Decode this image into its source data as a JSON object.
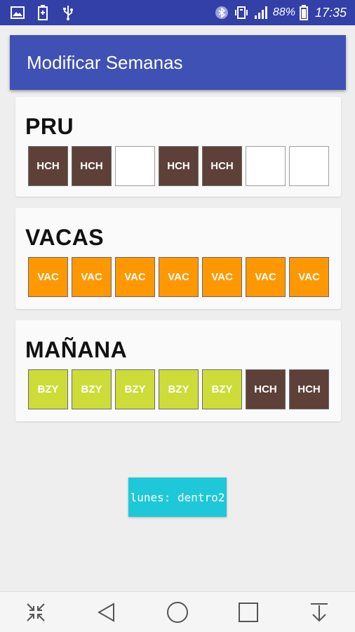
{
  "status_bar": {
    "battery": "88%",
    "time": "17:35",
    "icons": [
      "image-icon",
      "battery-saver-icon",
      "usb-icon",
      "bluetooth-icon",
      "vibrate-icon",
      "signal-icon",
      "battery-icon"
    ]
  },
  "toolbar": {
    "title": "Modificar Semanas",
    "color": "#3f51b5"
  },
  "cards": [
    {
      "title": "PRU",
      "days": [
        {
          "label": "HCH",
          "color": "#5d4037"
        },
        {
          "label": "HCH",
          "color": "#5d4037"
        },
        {
          "label": "",
          "color": "#ffffff"
        },
        {
          "label": "HCH",
          "color": "#5d4037"
        },
        {
          "label": "HCH",
          "color": "#5d4037"
        },
        {
          "label": "",
          "color": "#ffffff"
        },
        {
          "label": "",
          "color": "#ffffff"
        }
      ]
    },
    {
      "title": "VACAS",
      "days": [
        {
          "label": "VAC",
          "color": "#ff9800"
        },
        {
          "label": "VAC",
          "color": "#ff9800"
        },
        {
          "label": "VAC",
          "color": "#ff9800"
        },
        {
          "label": "VAC",
          "color": "#ff9800"
        },
        {
          "label": "VAC",
          "color": "#ff9800"
        },
        {
          "label": "VAC",
          "color": "#ff9800"
        },
        {
          "label": "VAC",
          "color": "#ff9800"
        }
      ]
    },
    {
      "title": "MAÑANA",
      "days": [
        {
          "label": "BZY",
          "color": "#cddc39"
        },
        {
          "label": "BZY",
          "color": "#cddc39"
        },
        {
          "label": "BZY",
          "color": "#cddc39"
        },
        {
          "label": "BZY",
          "color": "#cddc39"
        },
        {
          "label": "BZY",
          "color": "#cddc39"
        },
        {
          "label": "HCH",
          "color": "#5d4037"
        },
        {
          "label": "HCH",
          "color": "#5d4037"
        }
      ]
    }
  ],
  "action_button": {
    "label": "lunes: dentro2",
    "color": "#1ec8d8"
  },
  "nav_bar": {
    "icons": [
      "compress-icon",
      "back-icon",
      "home-icon",
      "recents-icon",
      "notification-pull-icon"
    ]
  }
}
